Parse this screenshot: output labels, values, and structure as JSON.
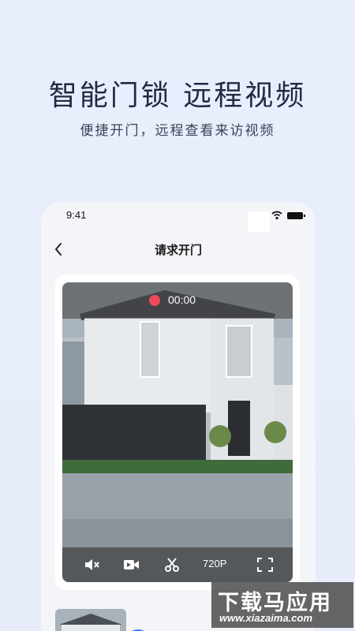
{
  "promo": {
    "headline": "智能门锁 远程视频",
    "subline": "便捷开门，远程查看来访视频"
  },
  "status_bar": {
    "time": "9:41",
    "icons": [
      "wifi-icon",
      "battery-icon"
    ]
  },
  "nav": {
    "back_icon": "chevron-left-icon",
    "title": "请求开门"
  },
  "video": {
    "recording_indicator_color": "#ec4b57",
    "recording_time": "00:00",
    "controls": {
      "mute_icon": "mute-icon",
      "record_icon": "video-camera-icon",
      "screenshot_icon": "scissors-icon",
      "quality_label": "720P",
      "fullscreen_icon": "fullscreen-icon"
    }
  },
  "bottom": {
    "blue_button_color": "#3c7cf0",
    "red_button_color": "#e04848"
  },
  "watermark": {
    "title": "下载马应用",
    "url": "www.xiazaima.com"
  }
}
